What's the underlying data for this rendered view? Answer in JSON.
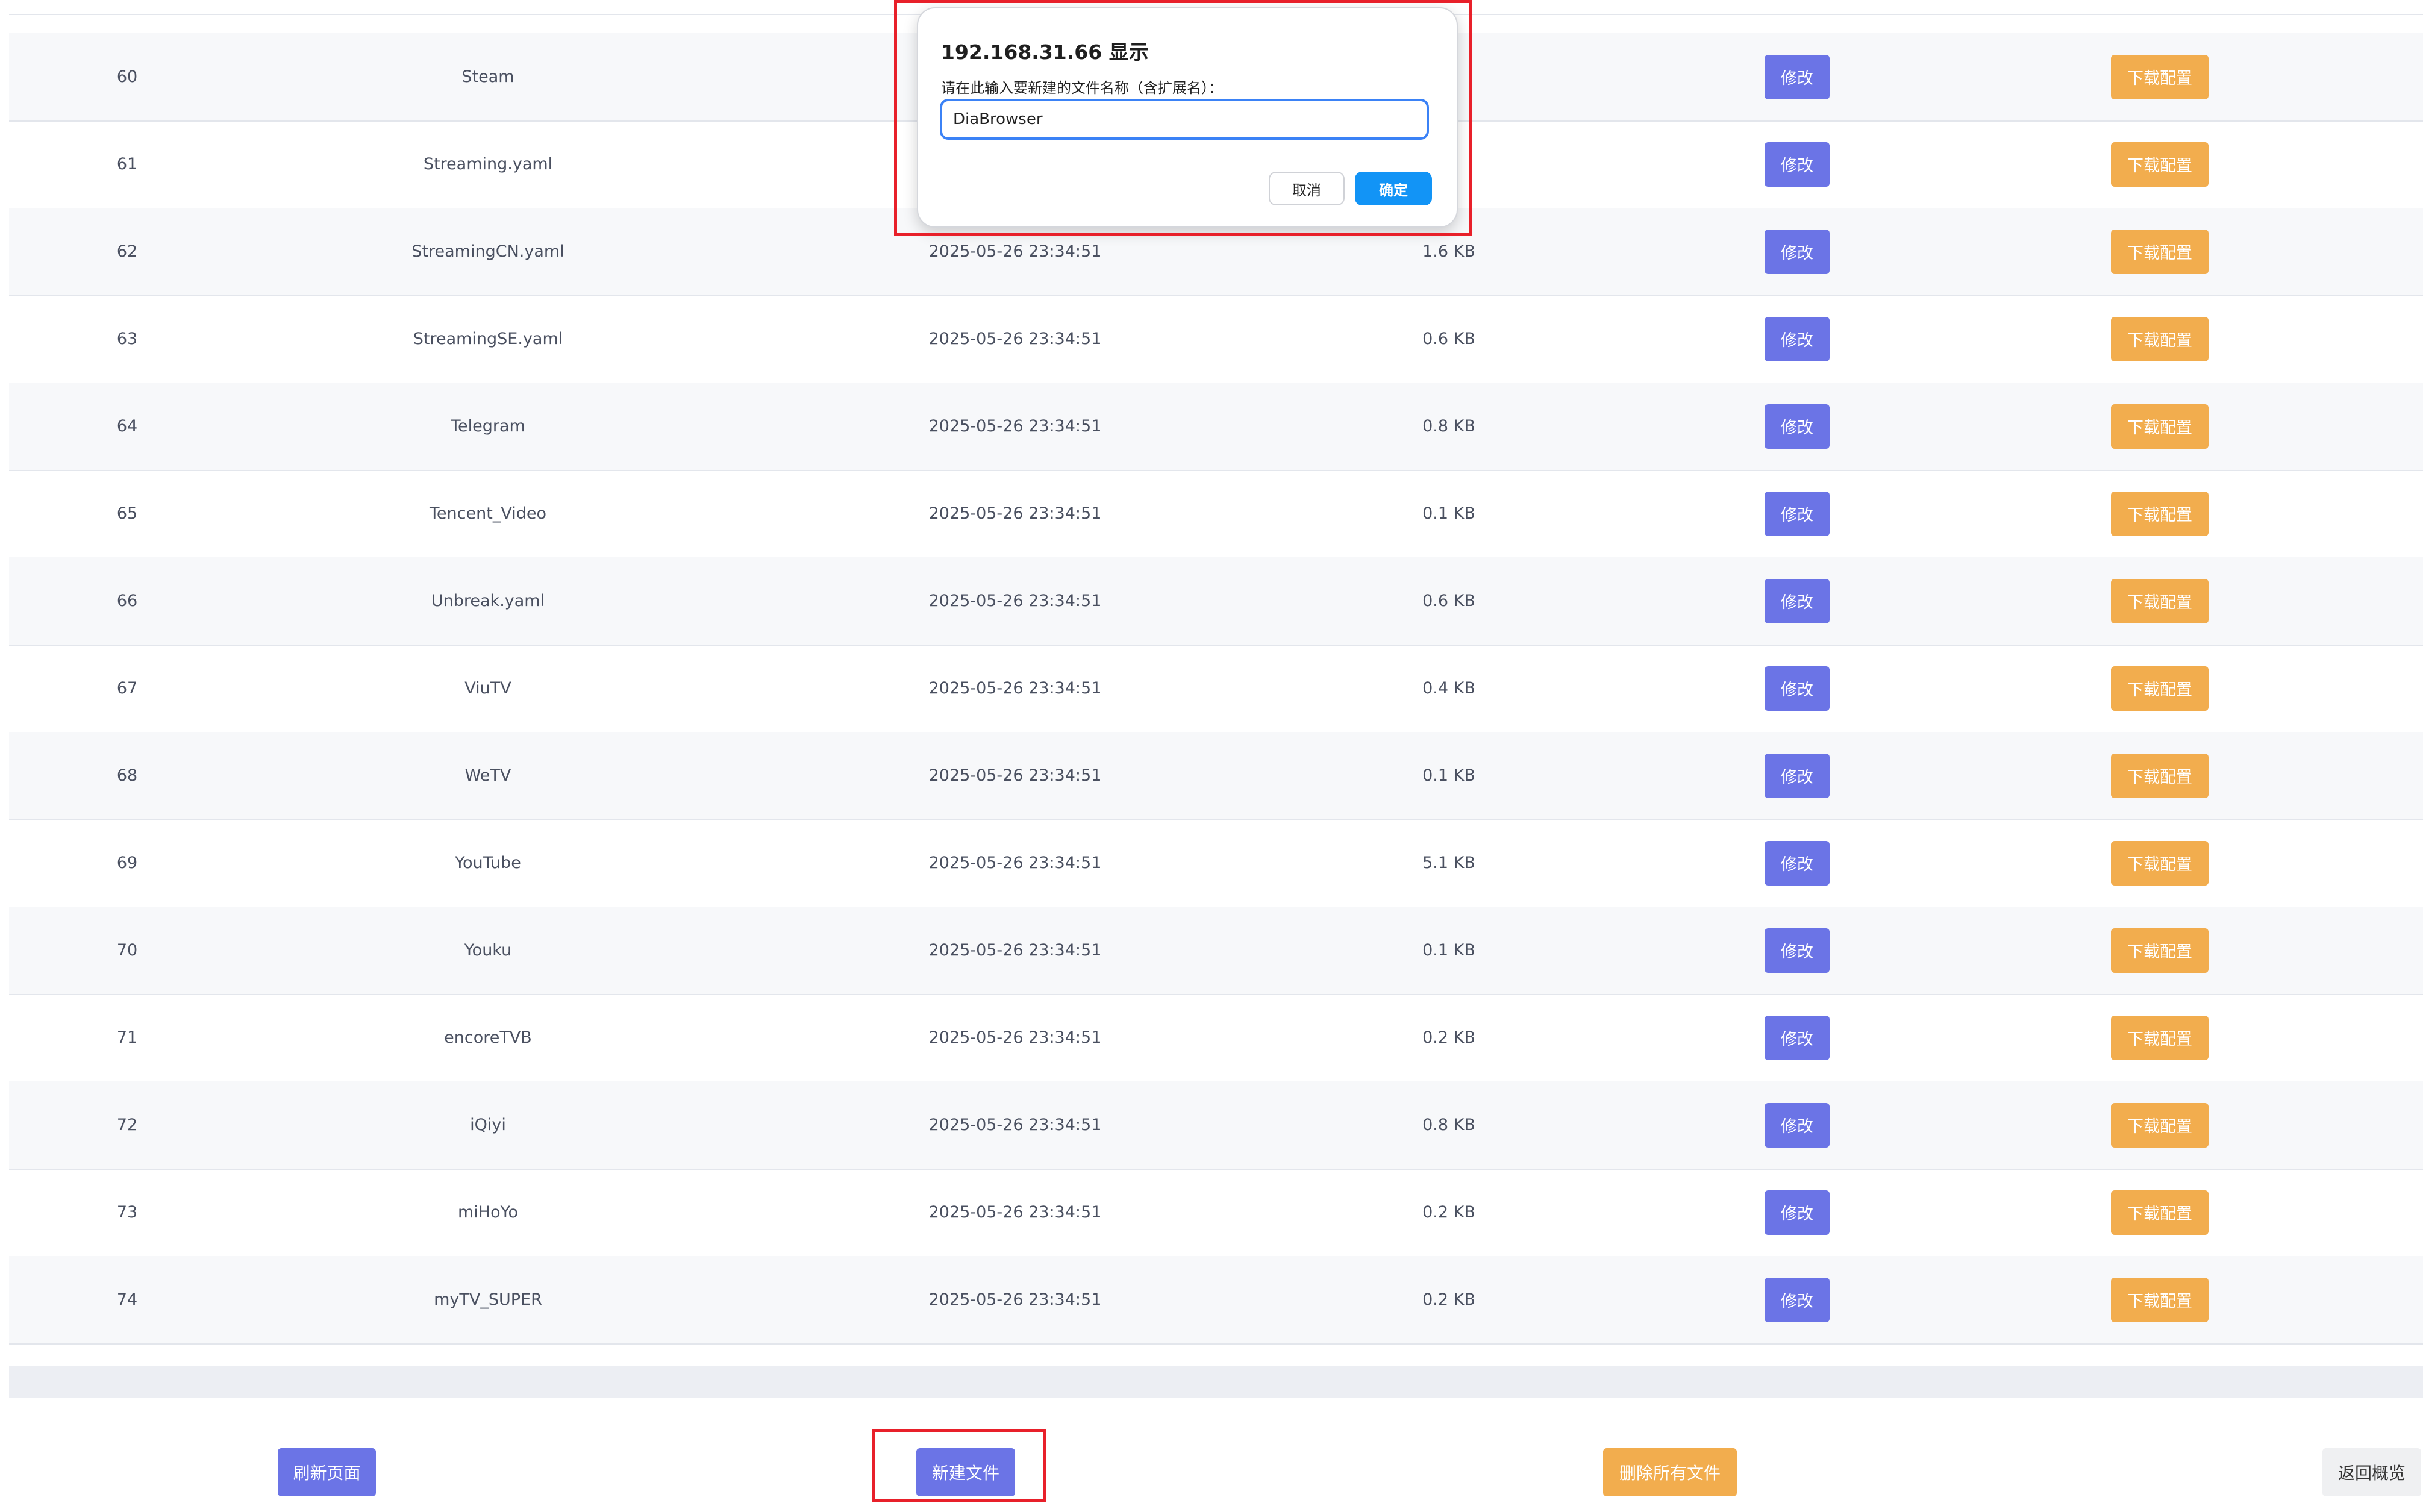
{
  "table": {
    "rows": [
      {
        "idx": "60",
        "name": "Steam",
        "date": "",
        "size": "",
        "edit": "修改",
        "download": "下载配置"
      },
      {
        "idx": "61",
        "name": "Streaming.yaml",
        "date": "",
        "size": "",
        "edit": "修改",
        "download": "下载配置"
      },
      {
        "idx": "62",
        "name": "StreamingCN.yaml",
        "date": "2025-05-26 23:34:51",
        "size": "1.6 KB",
        "edit": "修改",
        "download": "下载配置"
      },
      {
        "idx": "63",
        "name": "StreamingSE.yaml",
        "date": "2025-05-26 23:34:51",
        "size": "0.6 KB",
        "edit": "修改",
        "download": "下载配置"
      },
      {
        "idx": "64",
        "name": "Telegram",
        "date": "2025-05-26 23:34:51",
        "size": "0.8 KB",
        "edit": "修改",
        "download": "下载配置"
      },
      {
        "idx": "65",
        "name": "Tencent_Video",
        "date": "2025-05-26 23:34:51",
        "size": "0.1 KB",
        "edit": "修改",
        "download": "下载配置"
      },
      {
        "idx": "66",
        "name": "Unbreak.yaml",
        "date": "2025-05-26 23:34:51",
        "size": "0.6 KB",
        "edit": "修改",
        "download": "下载配置"
      },
      {
        "idx": "67",
        "name": "ViuTV",
        "date": "2025-05-26 23:34:51",
        "size": "0.4 KB",
        "edit": "修改",
        "download": "下载配置"
      },
      {
        "idx": "68",
        "name": "WeTV",
        "date": "2025-05-26 23:34:51",
        "size": "0.1 KB",
        "edit": "修改",
        "download": "下载配置"
      },
      {
        "idx": "69",
        "name": "YouTube",
        "date": "2025-05-26 23:34:51",
        "size": "5.1 KB",
        "edit": "修改",
        "download": "下载配置"
      },
      {
        "idx": "70",
        "name": "Youku",
        "date": "2025-05-26 23:34:51",
        "size": "0.1 KB",
        "edit": "修改",
        "download": "下载配置"
      },
      {
        "idx": "71",
        "name": "encoreTVB",
        "date": "2025-05-26 23:34:51",
        "size": "0.2 KB",
        "edit": "修改",
        "download": "下载配置"
      },
      {
        "idx": "72",
        "name": "iQiyi",
        "date": "2025-05-26 23:34:51",
        "size": "0.8 KB",
        "edit": "修改",
        "download": "下载配置"
      },
      {
        "idx": "73",
        "name": "miHoYo",
        "date": "2025-05-26 23:34:51",
        "size": "0.2 KB",
        "edit": "修改",
        "download": "下载配置"
      },
      {
        "idx": "74",
        "name": "myTV_SUPER",
        "date": "2025-05-26 23:34:51",
        "size": "0.2 KB",
        "edit": "修改",
        "download": "下载配置"
      }
    ]
  },
  "footer": {
    "refresh": "刷新页面",
    "new_file": "新建文件",
    "delete_all": "删除所有文件",
    "back": "返回概览"
  },
  "dialog": {
    "title": "192.168.31.66 显示",
    "message": "请在此输入要新建的文件名称（含扩展名）：",
    "input_value": "DiaBrowser",
    "cancel": "取消",
    "ok": "确定"
  },
  "colors": {
    "edit_button": "#6b74e6",
    "download_button": "#f2ad4e",
    "highlight": "#e8202a",
    "dialog_ok": "#1294f6"
  }
}
